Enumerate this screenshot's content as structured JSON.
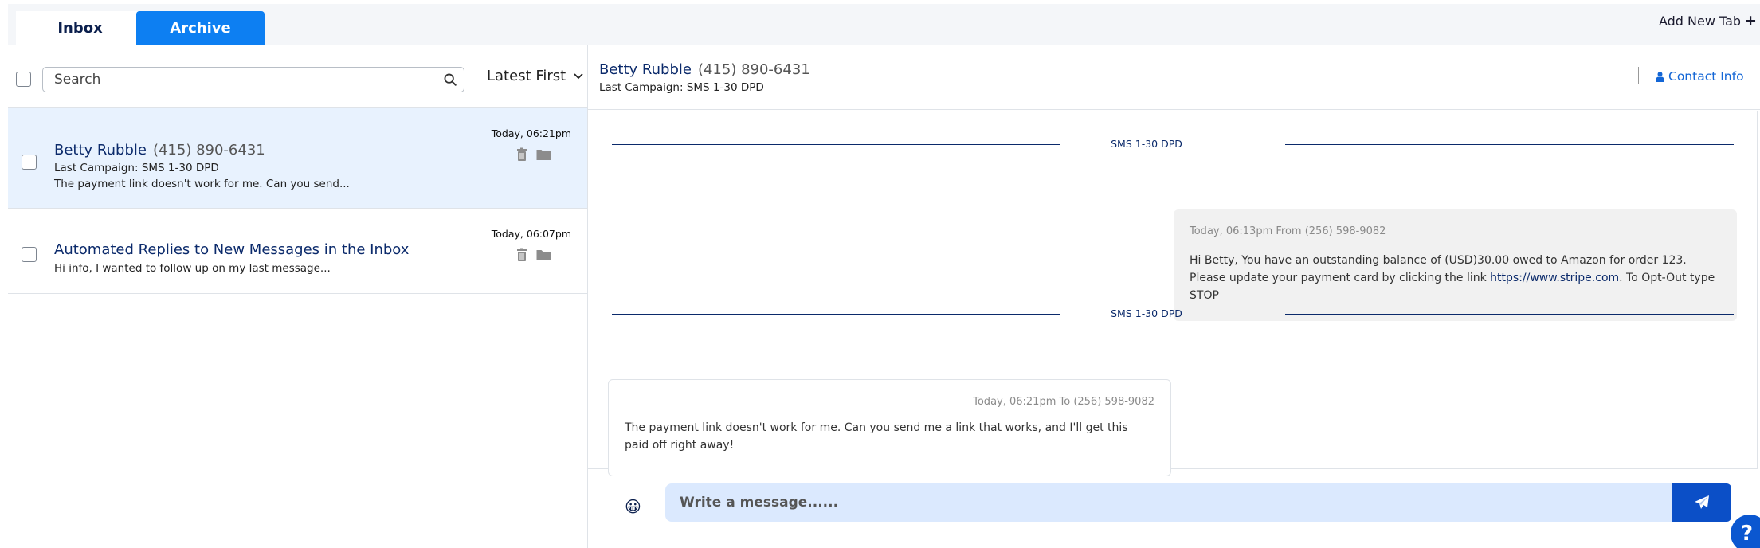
{
  "tabs": {
    "inbox_label": "Inbox",
    "archive_label": "Archive",
    "add_new_tab_label": "Add New Tab"
  },
  "list": {
    "search_placeholder": "Search",
    "sort_label": "Latest First",
    "conversations": [
      {
        "name": "Betty Rubble",
        "phone": "(415) 890-6431",
        "campaign": "Last Campaign: SMS 1-30 DPD",
        "preview": "The payment link doesn't work for me. Can you send...",
        "time": "Today, 06:21pm",
        "active": true
      },
      {
        "name": "Automated Replies to New Messages in the Inbox",
        "phone": "",
        "campaign": "",
        "preview": "Hi info, I wanted to follow up on my last message...",
        "time": "Today, 06:07pm",
        "active": false
      }
    ]
  },
  "conversation": {
    "name": "Betty Rubble",
    "phone": "(415) 890-6431",
    "campaign": "Last Campaign: SMS 1-30 DPD",
    "contact_info_label": "Contact Info",
    "separator_1": "SMS 1-30 DPD",
    "separator_2": "SMS 1-30 DPD",
    "outgoing": {
      "meta": "Today, 06:13pm From (256) 598-9082",
      "text_before_link": "Hi Betty, You have an outstanding balance of (USD)30.00 owed to Amazon for order 123. Please update your payment card by clicking the link ",
      "link": "https://www.stripe.com",
      "text_after_link": ". To Opt-Out type STOP"
    },
    "incoming": {
      "meta": "Today, 06:21pm To (256) 598-9082",
      "text": "The payment link doesn't work for me. Can you send me a link that works, and I'll get this paid off right away!"
    }
  },
  "composer": {
    "placeholder": "Write a message......",
    "emoji": "😀"
  },
  "help": {
    "label": "?"
  },
  "colors": {
    "accent": "#0d7ff2",
    "navy": "#0b2a6b",
    "active_row": "#e8f2fe",
    "composer_bg": "#dbe9fe",
    "send_btn": "#0b4fc7"
  }
}
